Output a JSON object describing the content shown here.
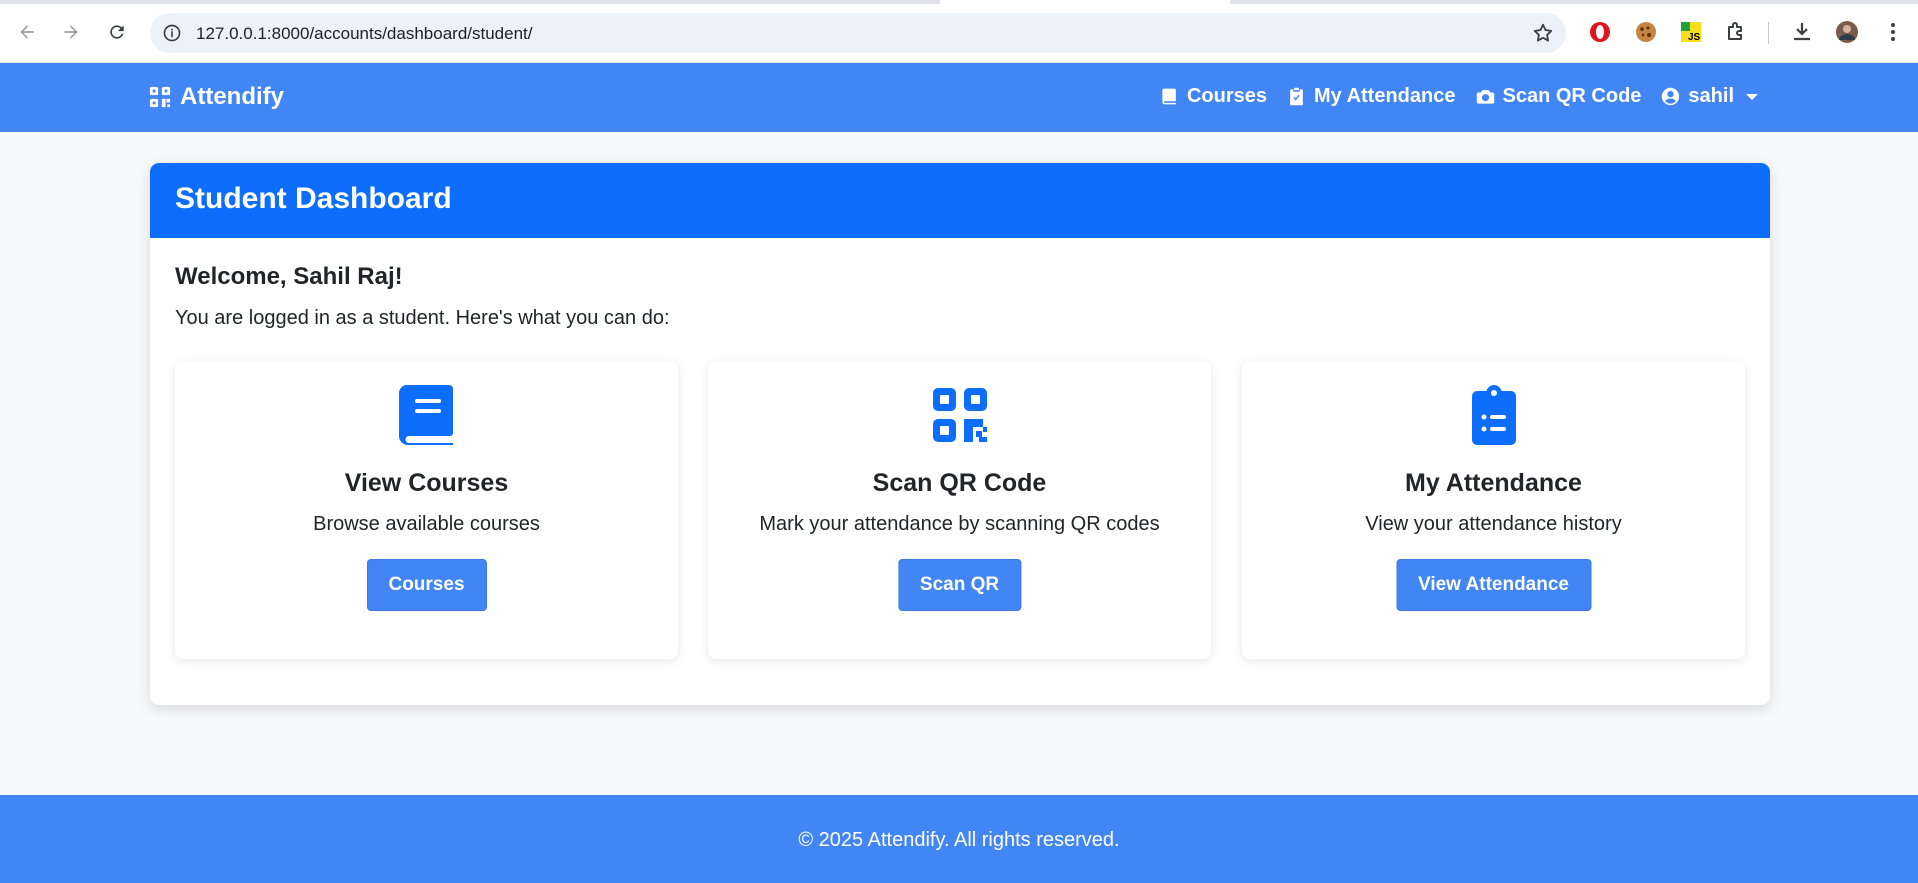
{
  "browser": {
    "url": "127.0.0.1:8000/accounts/dashboard/student/",
    "extensions": [
      "opera-icon",
      "cookie-icon",
      "js-icon",
      "puzzle-icon"
    ]
  },
  "navbar": {
    "brand": "Attendify",
    "links": [
      {
        "label": "Courses",
        "icon": "book-icon"
      },
      {
        "label": "My Attendance",
        "icon": "clipboard-check-icon"
      },
      {
        "label": "Scan QR Code",
        "icon": "camera-icon"
      },
      {
        "label": "sahil",
        "icon": "user-circle-icon"
      }
    ]
  },
  "dashboard": {
    "header": "Student Dashboard",
    "welcome": "Welcome, Sahil Raj!",
    "intro": "You are logged in as a student. Here's what you can do:",
    "features": [
      {
        "icon": "book-icon",
        "title": "View Courses",
        "description": "Browse available courses",
        "button": "Courses"
      },
      {
        "icon": "qr-code-icon",
        "title": "Scan QR Code",
        "description": "Mark your attendance by scanning QR codes",
        "button": "Scan QR"
      },
      {
        "icon": "clipboard-list-icon",
        "title": "My Attendance",
        "description": "View your attendance history",
        "button": "View Attendance"
      }
    ]
  },
  "footer": {
    "text": "© 2025 Attendify. All rights reserved."
  },
  "colors": {
    "navbar": "#4285f4",
    "header": "#0d6efd",
    "icon": "#0d6efd",
    "button": "#4285f4"
  }
}
